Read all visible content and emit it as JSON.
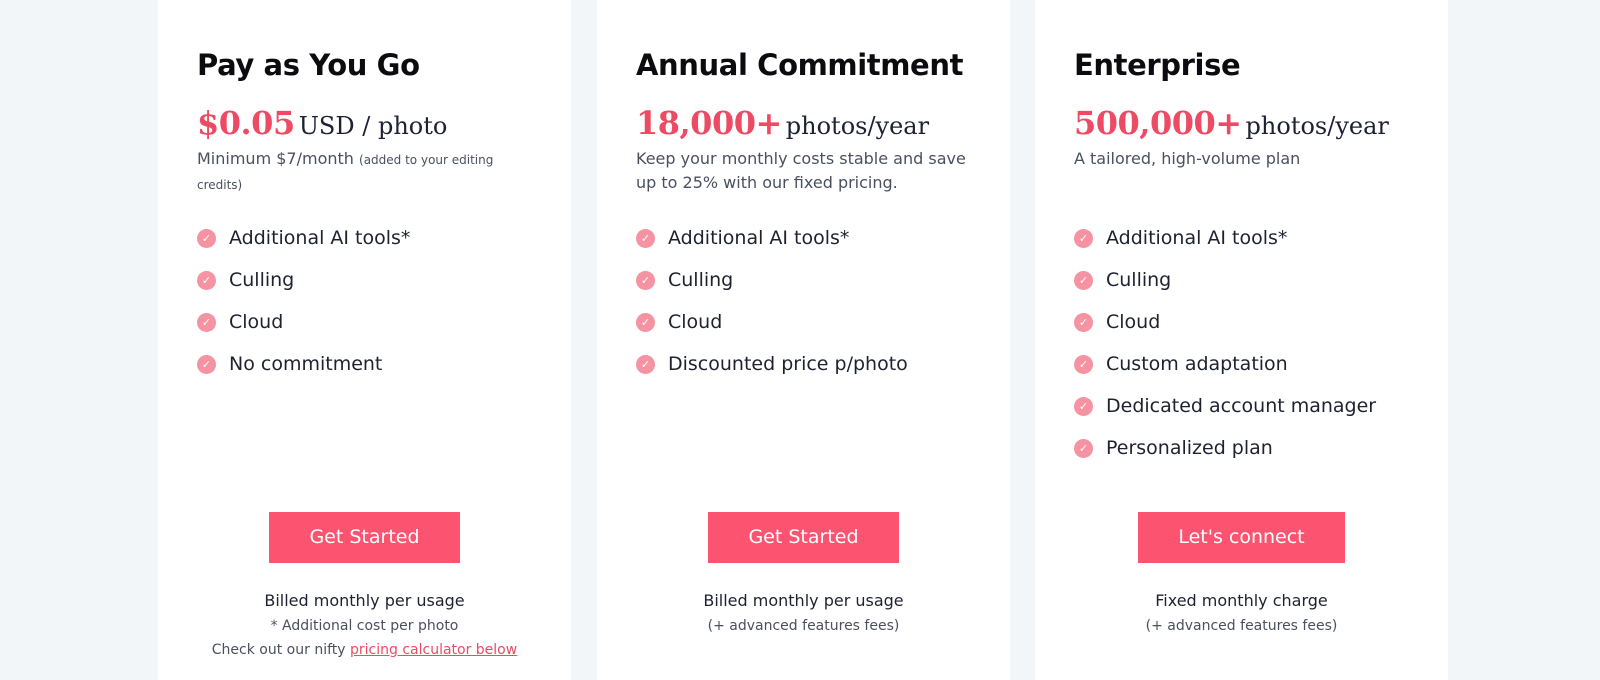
{
  "plans": [
    {
      "title": "Pay as You Go",
      "price_amount": "$0.05",
      "price_unit": "USD / photo",
      "subtext": "Minimum $7/month",
      "subtext_small": "(added to your editing credits)",
      "features": [
        "Additional AI tools*",
        "Culling",
        "Cloud",
        "No commitment"
      ],
      "cta_label": "Get Started",
      "billing": "Billed monthly per usage",
      "note": "* Additional cost per photo",
      "note2_prefix": "Check out our nifty",
      "note2_link": "pricing calculator below"
    },
    {
      "title": "Annual Commitment",
      "price_amount": "18,000+",
      "price_unit": "photos/year",
      "subtext": "Keep your monthly costs stable and save up to 25% with our fixed pricing.",
      "features": [
        "Additional AI tools*",
        "Culling",
        "Cloud",
        "Discounted price p/photo"
      ],
      "cta_label": "Get Started",
      "billing": "Billed monthly per usage",
      "note": "(+ advanced features fees)"
    },
    {
      "title": "Enterprise",
      "price_amount": "500,000+",
      "price_unit": "photos/year",
      "subtext": "A tailored, high-volume plan",
      "features": [
        "Additional AI tools*",
        "Culling",
        "Cloud",
        "Custom adaptation",
        "Dedicated account manager",
        "Personalized plan"
      ],
      "cta_label": "Let's connect",
      "billing": "Fixed monthly charge",
      "note": "(+ advanced features fees)"
    }
  ],
  "colors": {
    "accent": "#ec4b63",
    "button": "#fc5470",
    "check": "#f593a3",
    "background": "#f3f6f9",
    "card": "#ffffff"
  },
  "icons": {
    "feature_check": "check-circle-icon"
  }
}
